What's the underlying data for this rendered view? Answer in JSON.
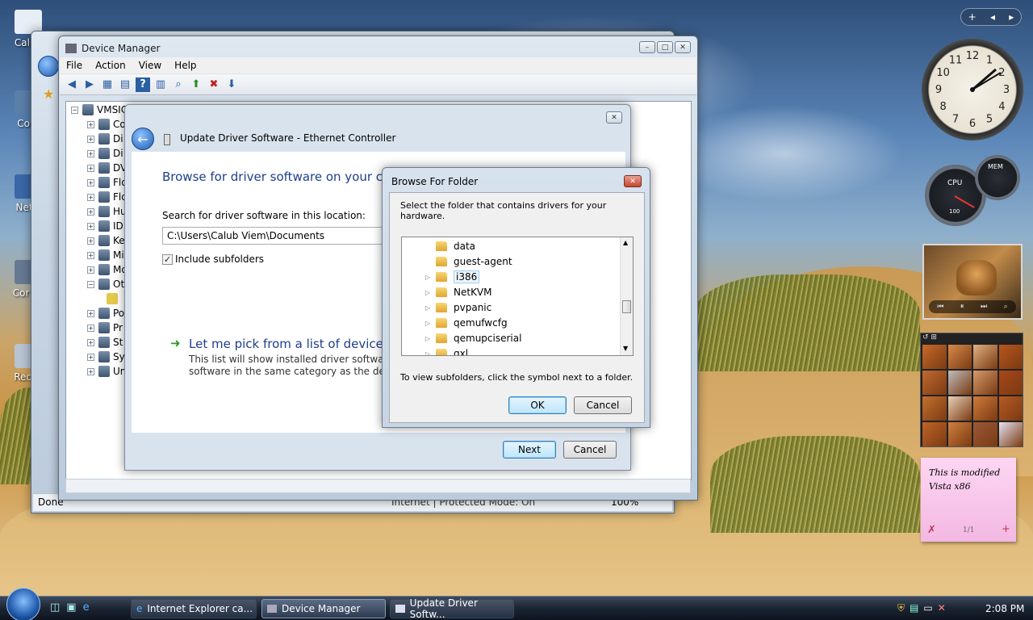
{
  "desktop": {
    "icons": [
      {
        "label": "Calub"
      },
      {
        "label": "Com"
      },
      {
        "label": "Netw"
      },
      {
        "label": "Cor Pa"
      },
      {
        "label": "Recyc"
      }
    ]
  },
  "device_manager": {
    "title": "Device Manager",
    "menu": [
      "File",
      "Action",
      "View",
      "Help"
    ],
    "tree_root": "VMSIC",
    "tree_items": [
      "Co",
      "Di",
      "Di",
      "DV",
      "Flo",
      "Flo",
      "Hu",
      "ID",
      "Ke",
      "Mi",
      "Mo",
      "Ot",
      "",
      "Po",
      "Pr",
      "St",
      "Sy",
      "Un"
    ]
  },
  "ie_window": {
    "status": "Done",
    "status_zone": "Internet | Protected Mode: On",
    "zoom": "100%"
  },
  "update_driver": {
    "title": "Update Driver Software - Ethernet Controller",
    "heading": "Browse for driver software on your com",
    "search_label": "Search for driver software in this location:",
    "path_value": "C:\\Users\\Calub Viem\\Documents",
    "include_subfolders": "Include subfolders",
    "pick_title": "Let me pick from a list of device dri",
    "pick_desc_line1": "This list will show installed driver software co",
    "pick_desc_line2": "software in the same category as the device.",
    "next": "Next",
    "cancel": "Cancel"
  },
  "browse_folder": {
    "title": "Browse For Folder",
    "instruction": "Select the folder that contains drivers for your hardware.",
    "folders": [
      {
        "name": "data",
        "expandable": false
      },
      {
        "name": "guest-agent",
        "expandable": false
      },
      {
        "name": "i386",
        "expandable": true,
        "selected": true
      },
      {
        "name": "NetKVM",
        "expandable": true
      },
      {
        "name": "pvpanic",
        "expandable": true
      },
      {
        "name": "qemufwcfg",
        "expandable": true
      },
      {
        "name": "qemupciserial",
        "expandable": true
      },
      {
        "name": "qxl",
        "expandable": true
      }
    ],
    "hint": "To view subfolders, click the symbol next to a folder.",
    "ok": "OK",
    "cancel": "Cancel"
  },
  "gadgets": {
    "clock_numbers": [
      "12",
      "1",
      "2",
      "3",
      "4",
      "5",
      "6",
      "7",
      "8",
      "9",
      "10",
      "11"
    ],
    "cpu_label": "CPU",
    "mem_label": "MEM",
    "cpu_value": "100",
    "note_line1": "This is modified",
    "note_line2": "Vista x86",
    "note_pager": "1/1"
  },
  "taskbar": {
    "tasks": [
      "Internet Explorer ca...",
      "Device Manager",
      "Update Driver Softw..."
    ],
    "clock": "2:08 PM"
  },
  "colors": {
    "accent": "#2b5ea3",
    "heading_blue": "#1e3e8c",
    "taskbar": "#1b2431"
  }
}
